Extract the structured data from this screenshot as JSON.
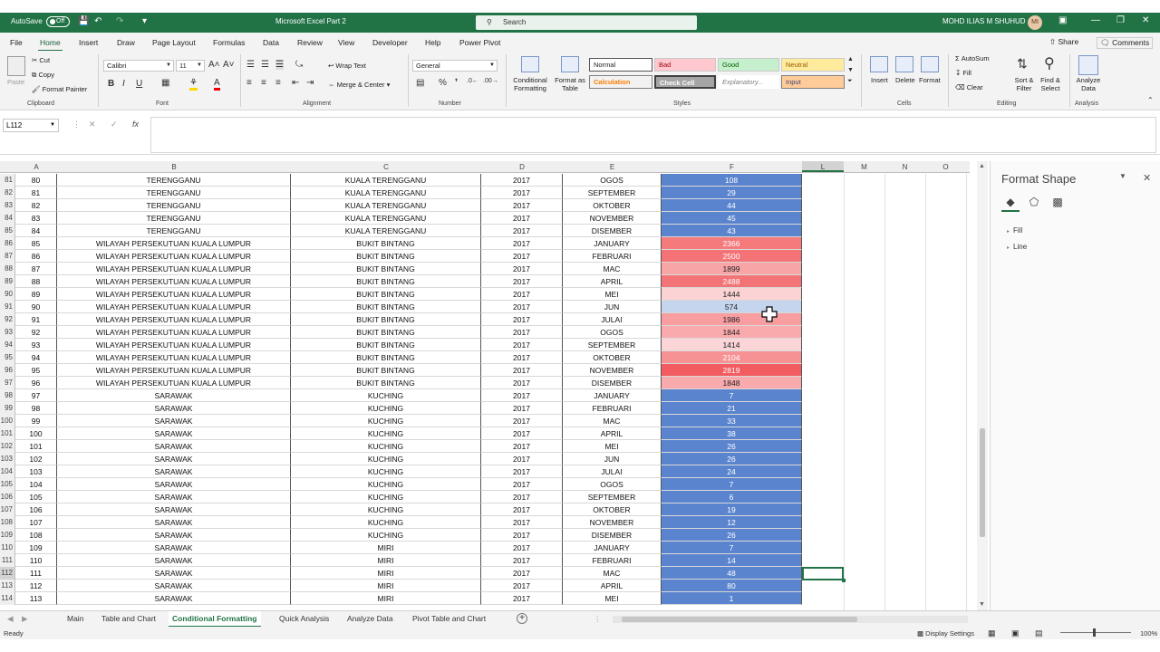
{
  "titlebar": {
    "autosave": "AutoSave",
    "autosave_state": "Off",
    "title": "Microsoft Excel Part 2",
    "search_placeholder": "Search",
    "user": "MOHD ILIAS M SHUHUD",
    "initials": "MI"
  },
  "menu": {
    "tabs": [
      "File",
      "Home",
      "Insert",
      "Draw",
      "Page Layout",
      "Formulas",
      "Data",
      "Review",
      "View",
      "Developer",
      "Help",
      "Power Pivot"
    ],
    "share": "Share",
    "comments": "Comments"
  },
  "ribbon": {
    "clipboard": {
      "paste": "Paste",
      "cut": "Cut",
      "copy": "Copy",
      "format_painter": "Format Painter",
      "label": "Clipboard"
    },
    "font": {
      "name": "Calibri",
      "size": "11",
      "label": "Font"
    },
    "alignment": {
      "wrap": "Wrap Text",
      "merge": "Merge & Center",
      "label": "Alignment"
    },
    "number": {
      "format": "General",
      "label": "Number"
    },
    "styles": {
      "cond_fmt_1": "Conditional",
      "cond_fmt_2": "Formatting",
      "fmt_table_1": "Format as",
      "fmt_table_2": "Table",
      "normal": "Normal",
      "bad": "Bad",
      "good": "Good",
      "neutral": "Neutral",
      "calculation": "Calculation",
      "check_cell": "Check Cell",
      "explanatory": "Explanatory...",
      "input": "Input",
      "label": "Styles"
    },
    "cells": {
      "insert": "Insert",
      "delete": "Delete",
      "format": "Format",
      "label": "Cells"
    },
    "editing": {
      "autosum": "AutoSum",
      "fill": "Fill",
      "clear": "Clear",
      "sort_1": "Sort &",
      "sort_2": "Filter",
      "find_1": "Find &",
      "find_2": "Select",
      "label": "Editing"
    },
    "analysis": {
      "analyze_1": "Analyze",
      "analyze_2": "Data",
      "label": "Analysis"
    }
  },
  "formula": {
    "namebox": "L112",
    "fx": "fx",
    "value": ""
  },
  "columns": [
    "A",
    "B",
    "C",
    "D",
    "E",
    "F",
    "L",
    "M",
    "N",
    "O"
  ],
  "rows": [
    {
      "n": "81",
      "a": "80",
      "b": "TERENGGANU",
      "c": "KUALA TERENGGANU",
      "d": "2017",
      "e": "OGOS",
      "f": "108",
      "fc": "#5b84cf"
    },
    {
      "n": "82",
      "a": "81",
      "b": "TERENGGANU",
      "c": "KUALA TERENGGANU",
      "d": "2017",
      "e": "SEPTEMBER",
      "f": "29",
      "fc": "#5b84cf"
    },
    {
      "n": "83",
      "a": "82",
      "b": "TERENGGANU",
      "c": "KUALA TERENGGANU",
      "d": "2017",
      "e": "OKTOBER",
      "f": "44",
      "fc": "#5b84cf"
    },
    {
      "n": "84",
      "a": "83",
      "b": "TERENGGANU",
      "c": "KUALA TERENGGANU",
      "d": "2017",
      "e": "NOVEMBER",
      "f": "45",
      "fc": "#5b84cf"
    },
    {
      "n": "85",
      "a": "84",
      "b": "TERENGGANU",
      "c": "KUALA TERENGGANU",
      "d": "2017",
      "e": "DISEMBER",
      "f": "43",
      "fc": "#5b84cf"
    },
    {
      "n": "86",
      "a": "85",
      "b": "WILAYAH PERSEKUTUAN KUALA LUMPUR",
      "c": "BUKIT BINTANG",
      "d": "2017",
      "e": "JANUARY",
      "f": "2366",
      "fc": "#f47a7c"
    },
    {
      "n": "87",
      "a": "86",
      "b": "WILAYAH PERSEKUTUAN KUALA LUMPUR",
      "c": "BUKIT BINTANG",
      "d": "2017",
      "e": "FEBRUARI",
      "f": "2500",
      "fc": "#f37376"
    },
    {
      "n": "88",
      "a": "87",
      "b": "WILAYAH PERSEKUTUAN KUALA LUMPUR",
      "c": "BUKIT BINTANG",
      "d": "2017",
      "e": "MAC",
      "f": "1899",
      "fc": "#f8a5a8"
    },
    {
      "n": "89",
      "a": "88",
      "b": "WILAYAH PERSEKUTUAN KUALA LUMPUR",
      "c": "BUKIT BINTANG",
      "d": "2017",
      "e": "APRIL",
      "f": "2488",
      "fc": "#f37477"
    },
    {
      "n": "90",
      "a": "89",
      "b": "WILAYAH PERSEKUTUAN KUALA LUMPUR",
      "c": "BUKIT BINTANG",
      "d": "2017",
      "e": "MEI",
      "f": "1444",
      "fc": "#fbd3d5"
    },
    {
      "n": "91",
      "a": "90",
      "b": "WILAYAH PERSEKUTUAN KUALA LUMPUR",
      "c": "BUKIT BINTANG",
      "d": "2017",
      "e": "JUN",
      "f": "574",
      "fc": "#c5d5ee"
    },
    {
      "n": "92",
      "a": "91",
      "b": "WILAYAH PERSEKUTUAN KUALA LUMPUR",
      "c": "BUKIT BINTANG",
      "d": "2017",
      "e": "JULAI",
      "f": "1986",
      "fc": "#f89da0"
    },
    {
      "n": "93",
      "a": "92",
      "b": "WILAYAH PERSEKUTUAN KUALA LUMPUR",
      "c": "BUKIT BINTANG",
      "d": "2017",
      "e": "OGOS",
      "f": "1844",
      "fc": "#f9aaad"
    },
    {
      "n": "94",
      "a": "93",
      "b": "WILAYAH PERSEKUTUAN KUALA LUMPUR",
      "c": "BUKIT BINTANG",
      "d": "2017",
      "e": "SEPTEMBER",
      "f": "1414",
      "fc": "#fbd5d7"
    },
    {
      "n": "95",
      "a": "94",
      "b": "WILAYAH PERSEKUTUAN KUALA LUMPUR",
      "c": "BUKIT BINTANG",
      "d": "2017",
      "e": "OKTOBER",
      "f": "2104",
      "fc": "#f69194"
    },
    {
      "n": "96",
      "a": "95",
      "b": "WILAYAH PERSEKUTUAN KUALA LUMPUR",
      "c": "BUKIT BINTANG",
      "d": "2017",
      "e": "NOVEMBER",
      "f": "2819",
      "fc": "#f25c60"
    },
    {
      "n": "97",
      "a": "96",
      "b": "WILAYAH PERSEKUTUAN KUALA LUMPUR",
      "c": "BUKIT BINTANG",
      "d": "2017",
      "e": "DISEMBER",
      "f": "1848",
      "fc": "#f9aaad"
    },
    {
      "n": "98",
      "a": "97",
      "b": "SARAWAK",
      "c": "KUCHING",
      "d": "2017",
      "e": "JANUARY",
      "f": "7",
      "fc": "#5b84cf"
    },
    {
      "n": "99",
      "a": "98",
      "b": "SARAWAK",
      "c": "KUCHING",
      "d": "2017",
      "e": "FEBRUARI",
      "f": "21",
      "fc": "#5b84cf"
    },
    {
      "n": "100",
      "a": "99",
      "b": "SARAWAK",
      "c": "KUCHING",
      "d": "2017",
      "e": "MAC",
      "f": "33",
      "fc": "#5b84cf"
    },
    {
      "n": "101",
      "a": "100",
      "b": "SARAWAK",
      "c": "KUCHING",
      "d": "2017",
      "e": "APRIL",
      "f": "38",
      "fc": "#5b84cf"
    },
    {
      "n": "102",
      "a": "101",
      "b": "SARAWAK",
      "c": "KUCHING",
      "d": "2017",
      "e": "MEI",
      "f": "26",
      "fc": "#5b84cf"
    },
    {
      "n": "103",
      "a": "102",
      "b": "SARAWAK",
      "c": "KUCHING",
      "d": "2017",
      "e": "JUN",
      "f": "26",
      "fc": "#5b84cf"
    },
    {
      "n": "104",
      "a": "103",
      "b": "SARAWAK",
      "c": "KUCHING",
      "d": "2017",
      "e": "JULAI",
      "f": "24",
      "fc": "#5b84cf"
    },
    {
      "n": "105",
      "a": "104",
      "b": "SARAWAK",
      "c": "KUCHING",
      "d": "2017",
      "e": "OGOS",
      "f": "7",
      "fc": "#5b84cf"
    },
    {
      "n": "106",
      "a": "105",
      "b": "SARAWAK",
      "c": "KUCHING",
      "d": "2017",
      "e": "SEPTEMBER",
      "f": "6",
      "fc": "#5b84cf"
    },
    {
      "n": "107",
      "a": "106",
      "b": "SARAWAK",
      "c": "KUCHING",
      "d": "2017",
      "e": "OKTOBER",
      "f": "19",
      "fc": "#5b84cf"
    },
    {
      "n": "108",
      "a": "107",
      "b": "SARAWAK",
      "c": "KUCHING",
      "d": "2017",
      "e": "NOVEMBER",
      "f": "12",
      "fc": "#5b84cf"
    },
    {
      "n": "109",
      "a": "108",
      "b": "SARAWAK",
      "c": "KUCHING",
      "d": "2017",
      "e": "DISEMBER",
      "f": "26",
      "fc": "#5b84cf"
    },
    {
      "n": "110",
      "a": "109",
      "b": "SARAWAK",
      "c": "MIRI",
      "d": "2017",
      "e": "JANUARY",
      "f": "7",
      "fc": "#5b84cf"
    },
    {
      "n": "111",
      "a": "110",
      "b": "SARAWAK",
      "c": "MIRI",
      "d": "2017",
      "e": "FEBRUARI",
      "f": "14",
      "fc": "#5b84cf"
    },
    {
      "n": "112",
      "a": "111",
      "b": "SARAWAK",
      "c": "MIRI",
      "d": "2017",
      "e": "MAC",
      "f": "48",
      "fc": "#5b84cf"
    },
    {
      "n": "113",
      "a": "112",
      "b": "SARAWAK",
      "c": "MIRI",
      "d": "2017",
      "e": "APRIL",
      "f": "80",
      "fc": "#5b84cf"
    },
    {
      "n": "114",
      "a": "113",
      "b": "SARAWAK",
      "c": "MIRI",
      "d": "2017",
      "e": "MEI",
      "f": "1",
      "fc": "#5b84cf"
    }
  ],
  "pane": {
    "title": "Format Shape",
    "sections": [
      "Fill",
      "Line"
    ]
  },
  "sheets": [
    "Main",
    "Table and Chart",
    "Conditional Formatting",
    "Quick Analysis",
    "Analyze Data",
    "Pivot Table and Chart"
  ],
  "active_sheet": "Conditional Formatting",
  "status": {
    "ready": "Ready",
    "display": "Display Settings",
    "zoom": "100%"
  }
}
